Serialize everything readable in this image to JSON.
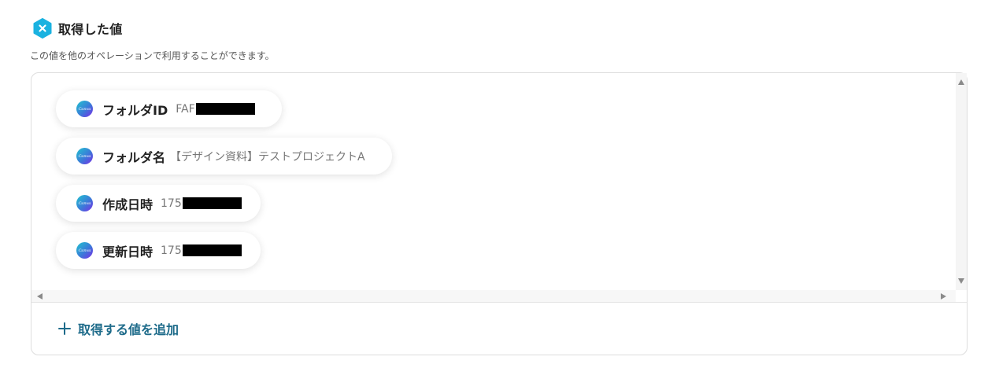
{
  "header": {
    "title": "取得した値",
    "description": "この値を他のオペレーションで利用することができます。",
    "icon": "yoom-x-icon"
  },
  "values": [
    {
      "label": "フォルダID",
      "value_prefix": "FAF",
      "redacted": true
    },
    {
      "label": "フォルダ名",
      "value_prefix": "【デザイン資料】テストプロジェクトA",
      "redacted": false
    },
    {
      "label": "作成日時",
      "value_prefix": "175",
      "redacted": true
    },
    {
      "label": "更新日時",
      "value_prefix": "175",
      "redacted": true
    }
  ],
  "app_icon": {
    "name": "canva-icon",
    "text": "Canva"
  },
  "add_button": {
    "label": "取得する値を追加"
  },
  "colors": {
    "accent": "#1e6b8a",
    "icon_teal": "#21c4cf"
  }
}
